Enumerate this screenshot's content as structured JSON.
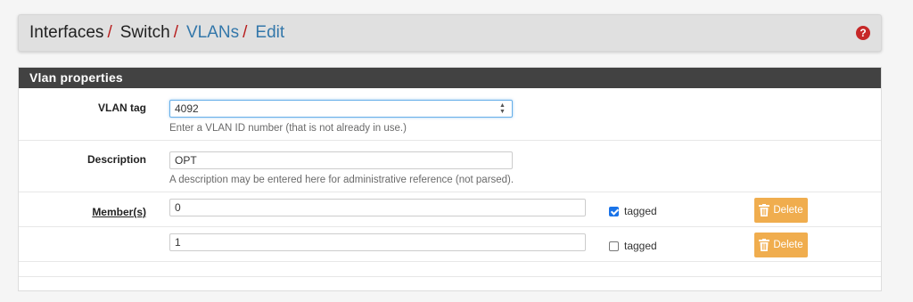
{
  "breadcrumb": {
    "items": [
      {
        "label": "Interfaces",
        "link": false
      },
      {
        "label": "Switch",
        "link": false
      },
      {
        "label": "VLANs",
        "link": true
      },
      {
        "label": "Edit",
        "link": true
      }
    ],
    "separator": "/"
  },
  "help_icon": "question-icon",
  "panel": {
    "title": "Vlan properties",
    "vlan_tag": {
      "label": "VLAN tag",
      "value": "4092",
      "help": "Enter a VLAN ID number (that is not already in use.)"
    },
    "description": {
      "label": "Description",
      "value": "OPT",
      "help": "A description may be entered here for administrative reference (not parsed)."
    },
    "members": {
      "label": "Member(s)",
      "rows": [
        {
          "value": "0",
          "tagged": true,
          "tagged_label": "tagged",
          "delete_label": "Delete"
        },
        {
          "value": "1",
          "tagged": false,
          "tagged_label": "tagged",
          "delete_label": "Delete"
        }
      ]
    }
  },
  "colors": {
    "accent_link": "#3377aa",
    "separator": "#b71c1c",
    "delete_button": "#f0ad4e",
    "panel_heading": "#424242"
  }
}
